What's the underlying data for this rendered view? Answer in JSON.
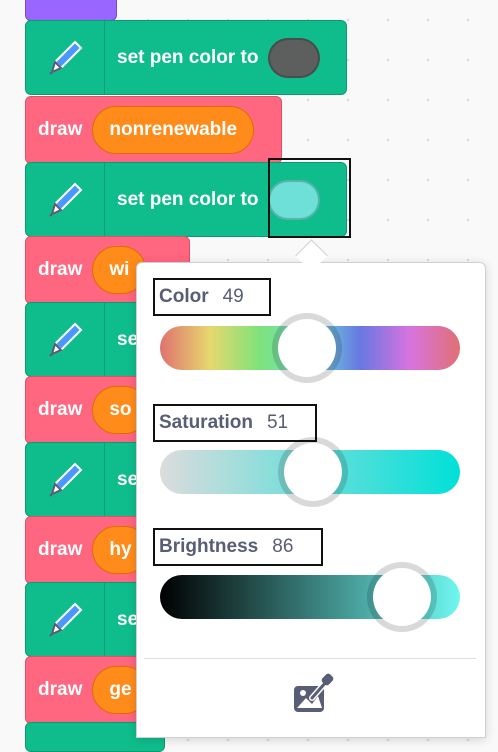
{
  "blocks": {
    "pen_label": "set pen color to",
    "draw_label": "draw",
    "pen_color_1": "#5d5e5e",
    "pen_color_2": "#6ee0d8",
    "draw_args": [
      "nonrenewable",
      "wi",
      "so",
      "hy",
      "ge"
    ],
    "pen_partial_label": "se"
  },
  "color_picker": {
    "color": {
      "label": "Color",
      "value": "49"
    },
    "saturation": {
      "label": "Saturation",
      "value": "51"
    },
    "brightness": {
      "label": "Brightness",
      "value": "86"
    },
    "color_fraction": 0.49,
    "saturation_fraction": 0.51,
    "brightness_fraction": 0.86
  },
  "icons": {
    "pen": "pen-icon",
    "eyedropper": "eyedropper-icon"
  },
  "colors": {
    "pen_block": "#0fbd8c",
    "draw_block": "#ff6680",
    "arg_pill": "#ff8c1a",
    "events_block": "#9966ff"
  }
}
